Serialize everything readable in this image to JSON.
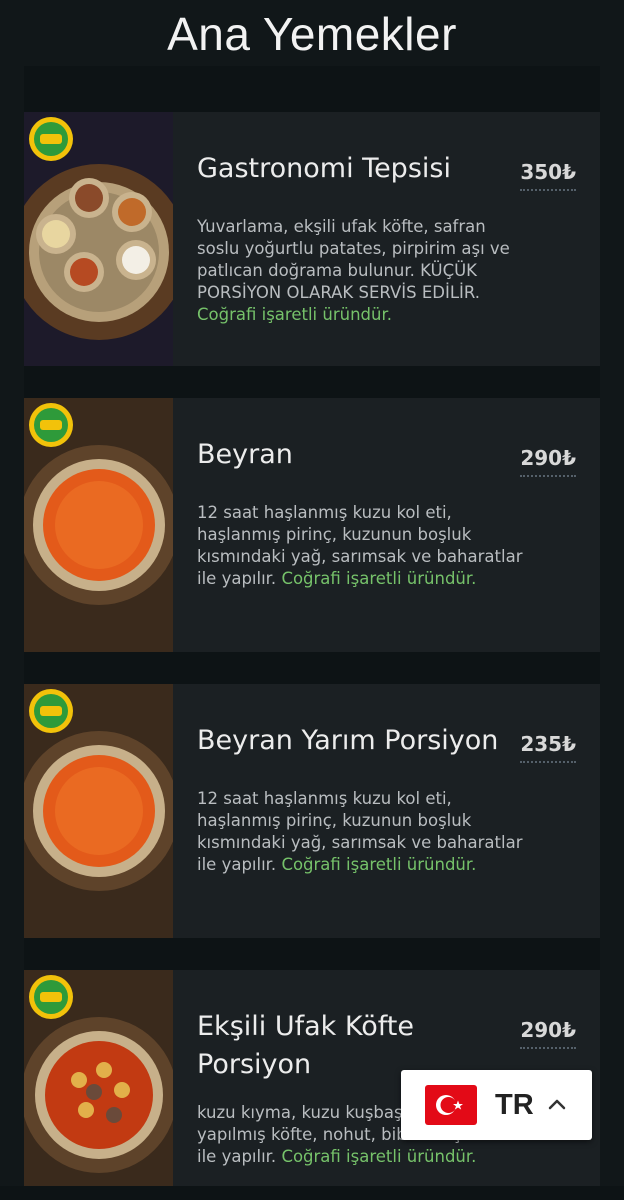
{
  "section_title": "Ana Yemekler",
  "colors": {
    "background": "#111719",
    "card_background": "#1b2023",
    "accent_green": "#76c26a",
    "flag_red": "#e30a17"
  },
  "items": [
    {
      "title": "Gastronomi Tepsisi",
      "price": "350₺",
      "description": "Yuvarlama, ekşili ufak köfte, safran soslu yoğurtlu patates, pirpirim aşı ve patlıcan doğrama bulunur. KÜÇÜK PORSİYON OLARAK SERVİS EDİLİR.",
      "note": "Coğrafi işaretli üründür.",
      "badge_icon": "geographical-indication-badge-icon"
    },
    {
      "title": "Beyran",
      "price": "290₺",
      "description": "12 saat haşlanmış kuzu kol eti, haşlanmış pirinç, kuzunun boşluk kısmındaki yağ, sarımsak ve baharatlar ile yapılır.",
      "note": "Coğrafi işaretli üründür.",
      "badge_icon": "geographical-indication-badge-icon"
    },
    {
      "title": "Beyran Yarım Porsiyon",
      "price": "235₺",
      "description": "12 saat haşlanmış kuzu kol eti, haşlanmış pirinç, kuzunun boşluk kısmındaki yağ, sarımsak ve baharatlar ile yapılır.",
      "note": "Coğrafi işaretli üründür.",
      "badge_icon": "geographical-indication-badge-icon"
    },
    {
      "title": "Ekşili Ufak Köfte Porsiyon",
      "price": "290₺",
      "description": "kuzu kıyma, kuzu kuşbaşı, bulgurdan yapılmış köfte, nohut, biber salça sos ile yapılır.",
      "note": "Coğrafi işaretli üründür.",
      "badge_icon": "geographical-indication-badge-icon"
    }
  ],
  "language_switcher": {
    "code": "TR",
    "flag_icon": "turkey-flag-icon",
    "toggle_icon": "chevron-up-icon"
  }
}
